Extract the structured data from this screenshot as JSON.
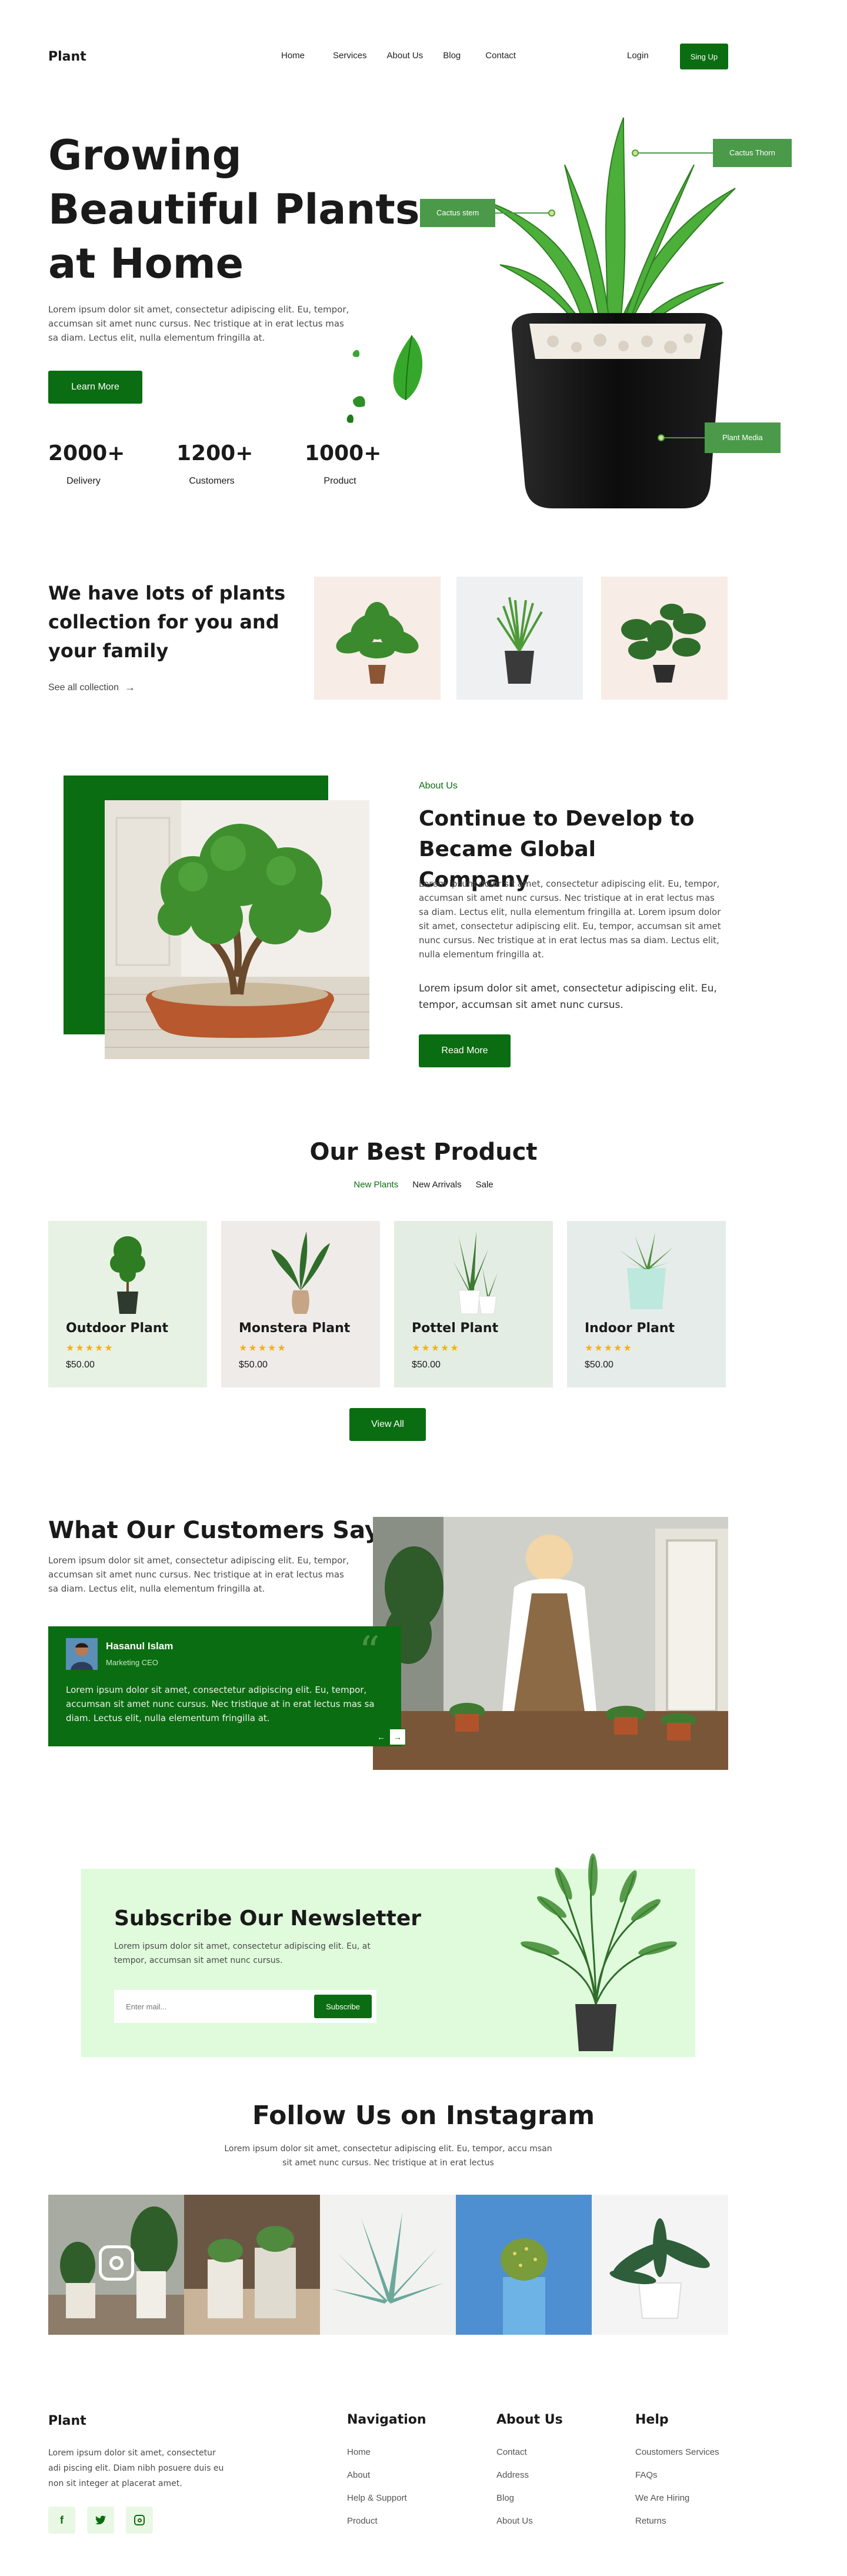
{
  "nav": {
    "logo": "Plant",
    "links": [
      "Home",
      "Services",
      "About Us",
      "Blog",
      "Contact"
    ],
    "login": "Login",
    "signup": "Sing Up"
  },
  "hero": {
    "title_lines": [
      "Growing",
      "Beautiful Plants",
      "at Home"
    ],
    "description": "Lorem ipsum dolor sit amet, consectetur adipiscing elit. Eu, tempor, accumsan sit amet nunc cursus. Nec tristique at in erat lectus mas sa diam. Lectus elit, nulla elementum fringilla at.",
    "cta": "Learn More",
    "stats": [
      {
        "value": "2000+",
        "label": "Delivery"
      },
      {
        "value": "1200+",
        "label": "Customers"
      },
      {
        "value": "1000+",
        "label": "Product"
      }
    ],
    "tags": {
      "stem": "Cactus stem",
      "thorn": "Cactus Thorn",
      "media": "Plant Media"
    }
  },
  "collection": {
    "title": "We have lots of plants collection for you and your family",
    "link": "See all collection"
  },
  "about": {
    "eyebrow": "About Us",
    "title": "Continue to Develop to Became Global Company",
    "p1": "Lorem ipsum dolor sit amet, consectetur adipiscing elit. Eu, tempor, accumsan sit amet nunc cursus. Nec tristique at in erat lectus mas sa diam. Lectus elit, nulla elementum fringilla at. Lorem ipsum dolor sit amet, consectetur adipiscing elit. Eu, tempor, accumsan sit amet nunc cursus. Nec tristique at in erat lectus mas sa diam. Lectus elit, nulla elementum fringilla at.",
    "p2": "Lorem ipsum dolor sit amet, consectetur adipiscing elit. Eu, tempor, accumsan sit amet nunc cursus.",
    "cta": "Read More"
  },
  "products": {
    "title": "Our Best Product",
    "tabs": [
      "New Plants",
      "New Arrivals",
      "Sale"
    ],
    "items": [
      {
        "name": "Outdoor Plant",
        "price": "$50.00",
        "stars": "★★★★★",
        "bg": "#e8f2e4"
      },
      {
        "name": "Monstera Plant",
        "price": "$50.00",
        "stars": "★★★★★",
        "bg": "#efebe8"
      },
      {
        "name": "Pottel Plant",
        "price": "$50.00",
        "stars": "★★★★★",
        "bg": "#e4ede4"
      },
      {
        "name": "Indoor Plant",
        "price": "$50.00",
        "stars": "★★★★★",
        "bg": "#e6ecea"
      }
    ],
    "cta": "View All"
  },
  "testimonial": {
    "title": "What Our Customers Says",
    "intro": "Lorem ipsum dolor sit amet, consectetur adipiscing elit. Eu, tempor, accumsan sit amet nunc cursus. Nec tristique at in erat lectus mas sa diam. Lectus elit, nulla elementum fringilla at.",
    "name": "Hasanul Islam",
    "role": "Marketing CEO",
    "quote": "Lorem ipsum dolor sit amet, consectetur adipiscing elit. Eu, tempor, accumsan sit amet nunc cursus. Nec tristique at in erat lectus mas sa diam. Lectus elit, nulla elementum fringilla at."
  },
  "newsletter": {
    "title": "Subscribe Our Newsletter",
    "text": "Lorem ipsum dolor sit amet, consectetur adipiscing elit. Eu, at tempor, accumsan sit amet nunc cursus.",
    "placeholder": "Enter mail...",
    "button": "Subscribe"
  },
  "instagram": {
    "title": "Follow Us on Instagram",
    "text": "Lorem ipsum dolor sit amet, consectetur adipiscing elit. Eu, tempor, accu msan sit amet nunc cursus. Nec tristique at in erat lectus"
  },
  "footer": {
    "logo": "Plant",
    "text": "Lorem ipsum dolor sit amet, consectetur adi piscing elit. Diam nibh posuere duis eu non sit integer at placerat amet.",
    "columns": [
      {
        "title": "Navigation",
        "links": [
          "Home",
          "About",
          "Help & Support",
          "Product"
        ]
      },
      {
        "title": "About Us",
        "links": [
          "Contact",
          "Address",
          "Blog",
          "About Us"
        ]
      },
      {
        "title": "Help",
        "links": [
          "Coustomers Services",
          "FAQs",
          "We Are Hiring",
          "Returns"
        ]
      }
    ]
  },
  "colors": {
    "primary": "#0b6d11",
    "accent": "#f5b400",
    "mint": "#e0fbdc"
  }
}
